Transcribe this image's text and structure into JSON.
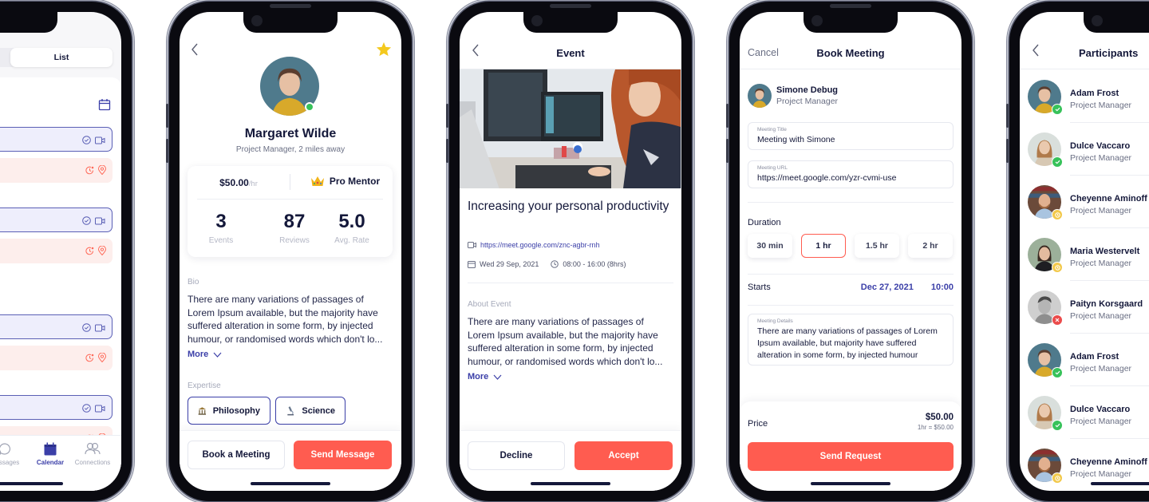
{
  "colors": {
    "primary": "#3b3fa8",
    "accent": "#ff5c50",
    "text": "#14183a",
    "muted": "#9aa0b1",
    "online": "#37c25a",
    "pending": "#f2c94c",
    "declined": "#eb4b4b",
    "star": "#f4c91e"
  },
  "calendar_screen": {
    "segment": {
      "selected": "List"
    },
    "calendar_icon": "calendar-icon",
    "events": [
      {
        "type": "online",
        "icons": [
          "check-circle-icon",
          "video-icon"
        ]
      },
      {
        "type": "offline",
        "icons": [
          "clock-pending-icon",
          "location-pin-icon"
        ]
      },
      {
        "type": "online",
        "icons": [
          "check-circle-icon",
          "video-icon"
        ]
      },
      {
        "type": "offline",
        "icons": [
          "clock-pending-icon",
          "location-pin-icon"
        ]
      },
      {
        "type": "online",
        "icons": [
          "check-circle-icon",
          "video-icon"
        ]
      },
      {
        "type": "offline",
        "icons": [
          "clock-pending-icon",
          "location-pin-icon"
        ]
      },
      {
        "type": "online",
        "icons": [
          "check-circle-icon",
          "video-icon"
        ]
      },
      {
        "type": "offline",
        "icons": [
          "clock-pending-icon",
          "location-pin-icon"
        ]
      }
    ],
    "tabbar": [
      {
        "label": "Messages",
        "icon": "chat-bubble-icon",
        "active": false
      },
      {
        "label": "Calendar",
        "icon": "calendar-icon",
        "active": true
      },
      {
        "label": "Connections",
        "icon": "people-icon",
        "active": false
      }
    ]
  },
  "profile_screen": {
    "name": "Margaret Wilde",
    "subtitle": "Project Manager, 2 miles away",
    "rate": "$50.00",
    "rate_unit": "/hr",
    "badge": "Pro Mentor",
    "stats": [
      {
        "value": "3",
        "label": "Events"
      },
      {
        "value": "87",
        "label": "Reviews"
      },
      {
        "value": "5.0",
        "label": "Avg. Rate"
      }
    ],
    "bio_label": "Bio",
    "bio": "There are many variations of passages of Lorem Ipsum available, but the majority have suffered alteration in some form, by injected humour, or randomised words which don't lo...",
    "more_label": "More",
    "expertise_label": "Expertise",
    "expertise": [
      {
        "label": "Philosophy",
        "icon": "classical-building-icon"
      },
      {
        "label": "Science",
        "icon": "microscope-icon"
      }
    ],
    "book_button": "Book a Meeting",
    "message_button": "Send Message"
  },
  "event_screen": {
    "header_title": "Event",
    "title": "Increasing your personal productivity",
    "link": "https://meet.google.com/znc-agbr-rnh",
    "date": "Wed 29 Sep, 2021",
    "time": "08:00 - 16:00 (8hrs)",
    "about_label": "About Event",
    "about": "There are many variations of passages of Lorem Ipsum available, but the majority have suffered alteration in some form, by injected humour, or randomised words which don't lo...",
    "more_label": "More",
    "decline_button": "Decline",
    "accept_button": "Accept"
  },
  "book_screen": {
    "cancel": "Cancel",
    "header_title": "Book Meeting",
    "user_name": "Simone Debug",
    "user_role": "Project Manager",
    "meeting_title_label": "Meeting Title",
    "meeting_title_value": "Meeting with Simone",
    "meeting_url_label": "Meeting URL",
    "meeting_url_value": "https://meet.google.com/yzr-cvmi-use",
    "duration_label": "Duration",
    "durations": [
      {
        "label": "30 min",
        "selected": false
      },
      {
        "label": "1 hr",
        "selected": true
      },
      {
        "label": "1.5 hr",
        "selected": false
      },
      {
        "label": "2 hr",
        "selected": false
      }
    ],
    "starts_label": "Starts",
    "starts_date": "Dec 27, 2021",
    "starts_time": "10:00",
    "details_label": "Meeting Details",
    "details_value": "There are many variations of passages of Lorem Ipsum available, but majority have suffered alteration in some form, by injected humour",
    "price_label": "Price",
    "price_value": "$50.00",
    "price_breakdown": "1hr = $50.00",
    "send_button": "Send Request"
  },
  "participants_screen": {
    "header_title": "Participants",
    "participants": [
      {
        "name": "Adam Frost",
        "role": "Project Manager",
        "status": "accepted"
      },
      {
        "name": "Dulce Vaccaro",
        "role": "Project Manager",
        "status": "accepted"
      },
      {
        "name": "Cheyenne Aminoff",
        "role": "Project Manager",
        "status": "pending"
      },
      {
        "name": "Maria Westervelt",
        "role": "Project Manager",
        "status": "pending"
      },
      {
        "name": "Paityn Korsgaard",
        "role": "Project Manager",
        "status": "declined"
      },
      {
        "name": "Adam Frost",
        "role": "Project Manager",
        "status": "accepted"
      },
      {
        "name": "Dulce Vaccaro",
        "role": "Project Manager",
        "status": "accepted"
      },
      {
        "name": "Cheyenne Aminoff",
        "role": "Project Manager",
        "status": "pending"
      }
    ]
  }
}
